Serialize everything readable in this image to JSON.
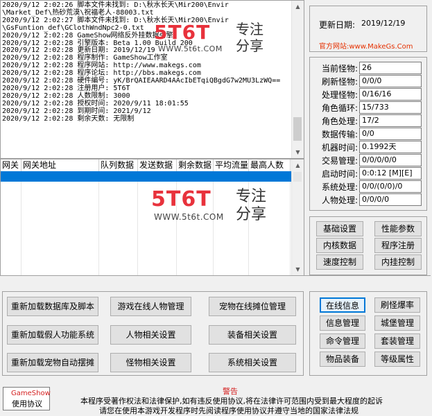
{
  "log": {
    "lines": [
      "2020/9/12 2:02:26 脚本文件未找到: D:\\秋水长天\\Mir200\\Envir",
      "\\Market_Def\\热砂荒漠\\祝福老人-88003.txt",
      "2020/9/12 2:02:27 脚本文件未找到: D:\\秋水长天\\Mir200\\Envir",
      "\\GsFuntion_def\\GClothWndNpc2-0.txt",
      "2020/9/12 2:02:28 GameShow网络反外挂数据引擎",
      "2020/9/12 2:02:28 引擎版本: Beta 1.00 Build 200",
      "2020/9/12 2:02:28 更新日期: 2019/12/19",
      "2020/9/12 2:02:28 程序制作: GameShow工作室",
      "2020/9/12 2:02:28 程序网站: http://www.makegs.com",
      "2020/9/12 2:02:28 程序论坛: http://bbs.makegs.com",
      "2020/9/12 2:02:28 硬件编号: yK/BrQAIEAARD4AAcIbETqiQBgdG7w2MU3LzWQ==",
      "2020/9/12 2:02:28 注册用户: 5T6T",
      "2020/9/12 2:02:28 人数限制: 3000",
      "2020/9/12 2:02:28 授权时间: 2020/9/11 18:01:55",
      "2020/9/12 2:02:28 到期时间: 2021/9/12",
      "2020/9/12 2:02:28 剩余天数: 无限制"
    ]
  },
  "table": {
    "headers": [
      "网关",
      "网关地址",
      "队列数据",
      "发送数据",
      "剩余数据",
      "平均流量",
      "最高人数"
    ]
  },
  "watermark": {
    "brand": "5T6T",
    "slogan_1": "专注",
    "slogan_2": "分享",
    "url": "WWW.5t6t.COM"
  },
  "info": {
    "update_label": "更新日期:",
    "update_value": "2019/12/19",
    "site": "官方网站:www.MakeGs.Com"
  },
  "stats": [
    {
      "label": "当前怪物:",
      "value": "26"
    },
    {
      "label": "刷新怪物:",
      "value": "0/0/0"
    },
    {
      "label": "处理怪物:",
      "value": "0/16/16"
    },
    {
      "label": "角色循环:",
      "value": "15/733"
    },
    {
      "label": "角色处理:",
      "value": "17/2"
    },
    {
      "label": "数据传输:",
      "value": "0/0"
    },
    {
      "label": "机器时间:",
      "value": "0.1992天"
    },
    {
      "label": "交易管理:",
      "value": "0/0/0/0/0"
    },
    {
      "label": "启动时间:",
      "value": "0:0:12 [M][E]"
    },
    {
      "label": "系统处理:",
      "value": "0/0/(0/0)/0"
    },
    {
      "label": "人物处理:",
      "value": "0/0/0/0"
    }
  ],
  "right_buttons": [
    "基础设置",
    "性能参数",
    "内核数据",
    "程序注册",
    "速度控制",
    "内挂控制"
  ],
  "main_buttons": [
    "重新加载数据库及脚本",
    "游戏在线人物管理",
    "宠物在线摊位管理",
    "重新加载假人功能系统",
    "人物相关设置",
    "装备相关设置",
    "重新加载宠物自动摆摊",
    "怪物相关设置",
    "系统相关设置"
  ],
  "side_buttons": [
    "在线信息",
    "刷怪爆率",
    "信息管理",
    "城堡管理",
    "命令管理",
    "套装管理",
    "物品装备",
    "等级属性"
  ],
  "footer": {
    "gs_line1": "GameShow",
    "gs_line2": "使用协议",
    "warn_title": "警告",
    "warn_line1": "本程序受著作权法和法律保护,如有违反使用协议,将在法律许可范围内受到最大程度的起诉",
    "warn_line2": "请您在使用本游戏开发程序时先阅读程序使用协议并遵守当地的国家法律法规"
  }
}
